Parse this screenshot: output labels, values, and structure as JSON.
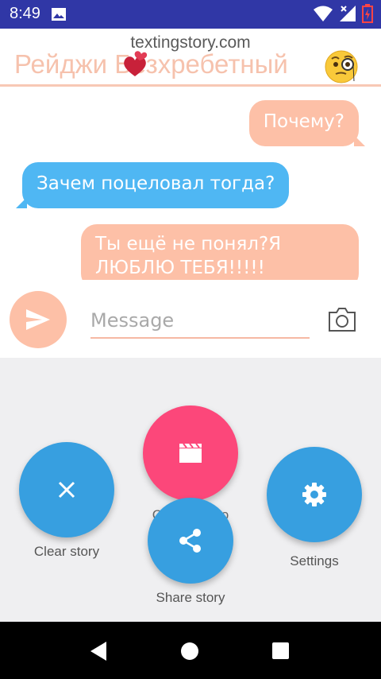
{
  "status_bar": {
    "time": "8:49"
  },
  "header": {
    "watermark": "textingstory.com",
    "title": "Рейджи Безхребетный"
  },
  "messages": [
    {
      "side": "right",
      "text": "Почему?"
    },
    {
      "side": "left",
      "text": "Зачем поцеловал тогда?"
    },
    {
      "side": "right",
      "text": "Ты ещё не понял?Я ЛЮБЛЮ ТЕБЯ!!!!!"
    }
  ],
  "input": {
    "placeholder": "Message"
  },
  "actions": {
    "clear_label": "Clear story",
    "video_label": "Create video",
    "share_label": "Share story",
    "settings_label": "Settings"
  },
  "colors": {
    "status_bar": "#3037a6",
    "accent_peach": "#fdc0a7",
    "bubble_blue": "#4fb7f3",
    "fab_blue": "#379fe0",
    "fab_pink": "#fc477a"
  }
}
